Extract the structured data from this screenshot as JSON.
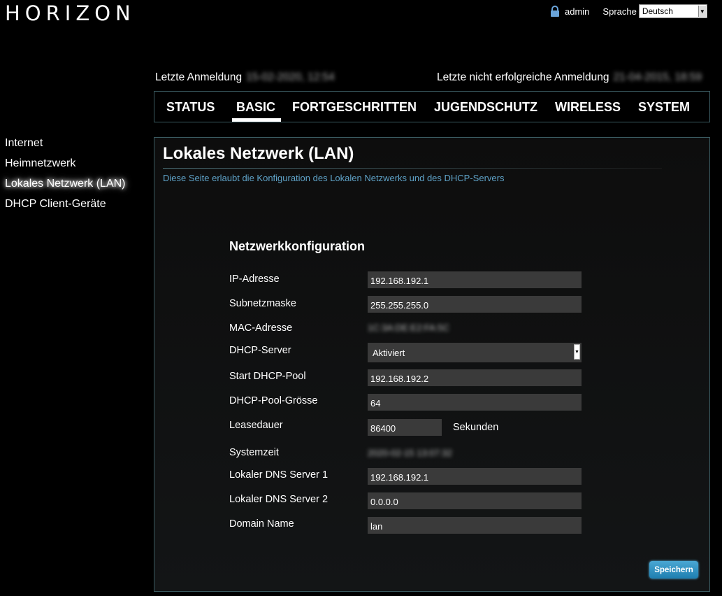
{
  "header": {
    "logo": "HORIZON",
    "user": "admin",
    "language_label": "Sprache",
    "language_value": "Deutsch"
  },
  "login": {
    "last_login_label": "Letzte Anmeldung",
    "last_login_value": "15-02-2020, 12:54",
    "last_failed_label": "Letzte nicht erfolgreiche Anmeldung",
    "last_failed_value": "21-04-2015, 18:59"
  },
  "nav": {
    "tabs": [
      {
        "label": "STATUS"
      },
      {
        "label": "BASIC"
      },
      {
        "label": "FORTGESCHRITTEN"
      },
      {
        "label": "JUGENDSCHUTZ"
      },
      {
        "label": "WIRELESS"
      },
      {
        "label": "SYSTEM"
      }
    ],
    "active": "BASIC"
  },
  "sidebar": {
    "items": [
      {
        "label": "Internet"
      },
      {
        "label": "Heimnetzwerk"
      },
      {
        "label": "Lokales Netzwerk (LAN)"
      },
      {
        "label": "DHCP Client-Geräte"
      }
    ],
    "active": "Lokales Netzwerk (LAN)"
  },
  "page": {
    "title": "Lokales Netzwerk (LAN)",
    "description": "Diese Seite erlaubt die Konfiguration des Lokalen Netzwerks und des DHCP-Servers"
  },
  "form": {
    "section_title": "Netzwerkkonfiguration",
    "ip_label": "IP-Adresse",
    "ip_value": "192.168.192.1",
    "subnet_label": "Subnetzmaske",
    "subnet_value": "255.255.255.0",
    "mac_label": "MAC-Adresse",
    "mac_value": "1C:3A:DE:E2:FA:5C",
    "dhcp_label": "DHCP-Server",
    "dhcp_value": "Aktiviert",
    "start_pool_label": "Start DHCP-Pool",
    "start_pool_value": "192.168.192.2",
    "pool_size_label": "DHCP-Pool-Grösse",
    "pool_size_value": "64",
    "lease_label": "Leasedauer",
    "lease_value": "86400",
    "lease_unit": "Sekunden",
    "systime_label": "Systemzeit",
    "systime_value": "2020-02-15 13:07:32",
    "dns1_label": "Lokaler DNS Server 1",
    "dns1_value": "192.168.192.1",
    "dns2_label": "Lokaler DNS Server 2",
    "dns2_value": "0.0.0.0",
    "domain_label": "Domain Name",
    "domain_value": "lan",
    "save_label": "Speichern"
  }
}
